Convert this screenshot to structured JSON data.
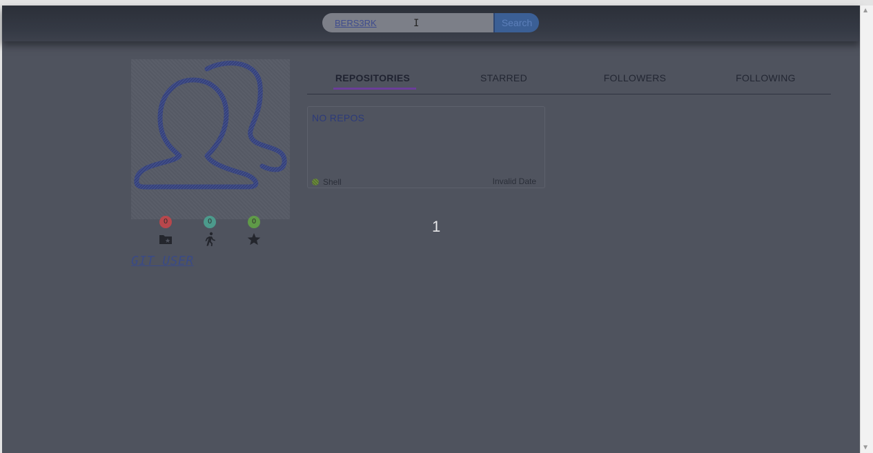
{
  "search": {
    "value": "BERS3RK",
    "button_label": "Search"
  },
  "profile": {
    "username": "GIT USER",
    "stats": [
      {
        "value": "0",
        "icon": "repo-folder-star-icon",
        "color": "#b8474c"
      },
      {
        "value": "0",
        "icon": "runner-icon",
        "color": "#4c9a8c"
      },
      {
        "value": "0",
        "icon": "star-icon",
        "color": "#5f9a48"
      }
    ]
  },
  "tabs": [
    {
      "label": "REPOSITORIES",
      "active": true
    },
    {
      "label": "STARRED",
      "active": false
    },
    {
      "label": "FOLLOWERS",
      "active": false
    },
    {
      "label": "FOLLOWING",
      "active": false
    }
  ],
  "repo_card": {
    "title": "NO REPOS",
    "language": "Shell",
    "date": "Invalid Date"
  },
  "pagination": {
    "current": "1"
  },
  "colors": {
    "accent": "#6b3d9a",
    "overlay": "#4f535e"
  }
}
